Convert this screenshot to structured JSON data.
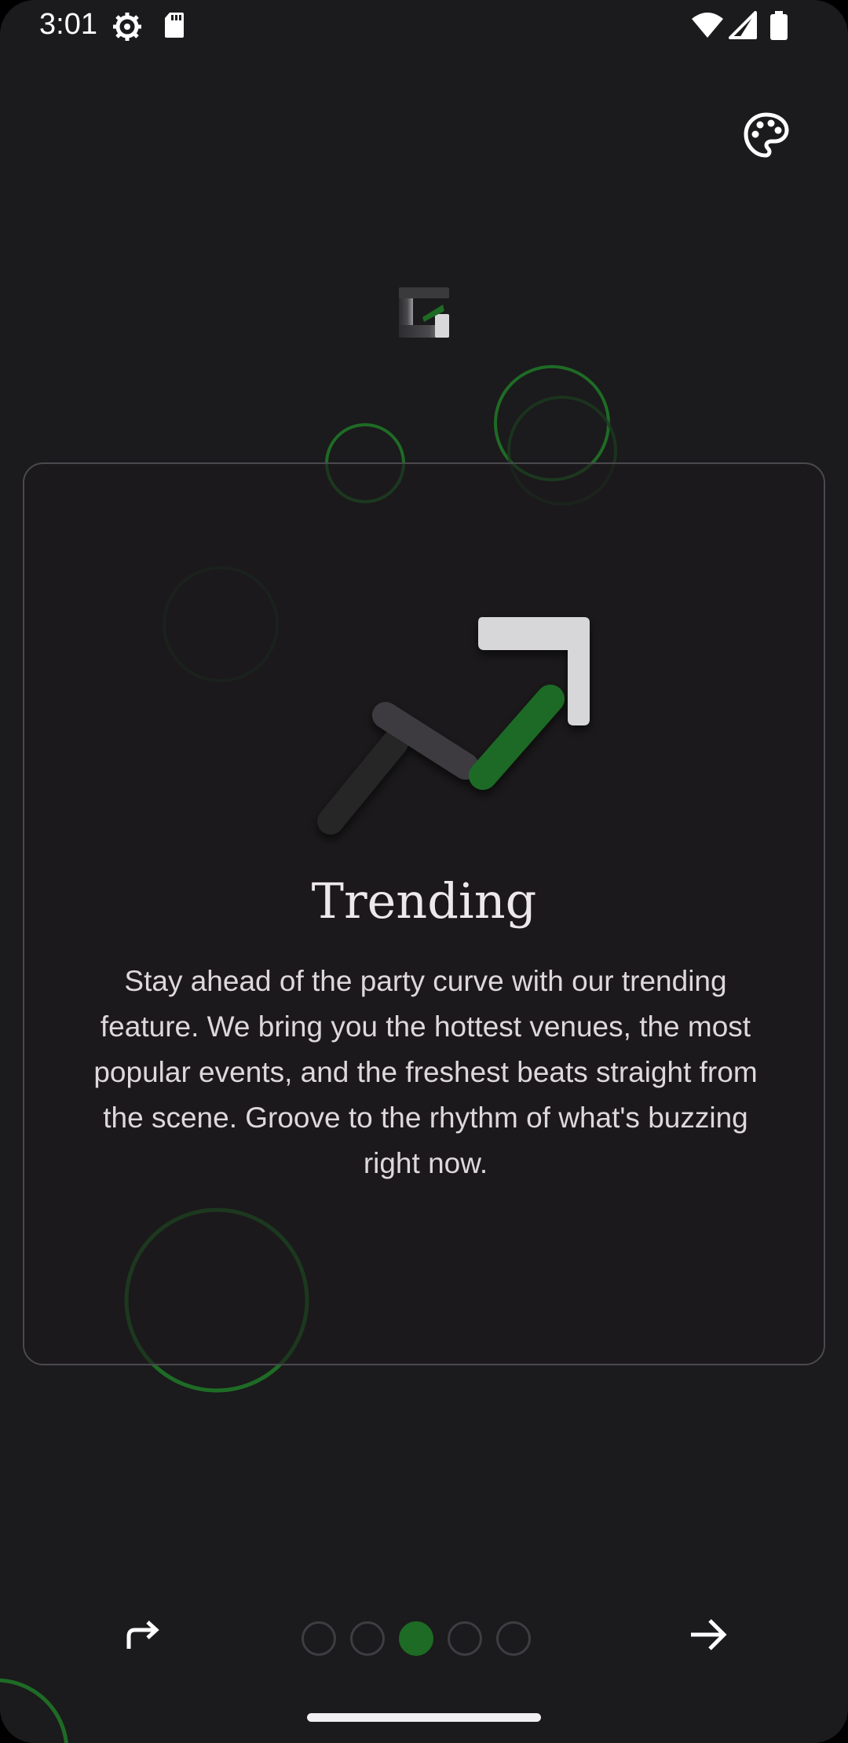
{
  "status_bar": {
    "time": "3:01",
    "icons": [
      "settings-gear-icon",
      "sd-card-icon",
      "wifi-icon",
      "signal-icon",
      "battery-icon"
    ]
  },
  "toolbar": {
    "theme_icon": "palette-icon"
  },
  "logo": {
    "icon": "app-logo-icon"
  },
  "onboarding": {
    "illustration_icon": "trending-arrow-icon",
    "title": "Trending",
    "description": "Stay ahead of the party curve with our trending feature. We bring you the hottest venues, the most popular events, and the freshest beats straight from the scene. Groove to the rhythm of what's buzzing right now."
  },
  "navigation": {
    "skip_icon": "skip-arrow-icon",
    "next_icon": "arrow-right-icon",
    "page_count": 5,
    "current_page": 3
  },
  "colors": {
    "background": "#1b1a1c",
    "accent": "#1e6b25",
    "card_border": "#4a494d",
    "text": "#ece8ec"
  }
}
